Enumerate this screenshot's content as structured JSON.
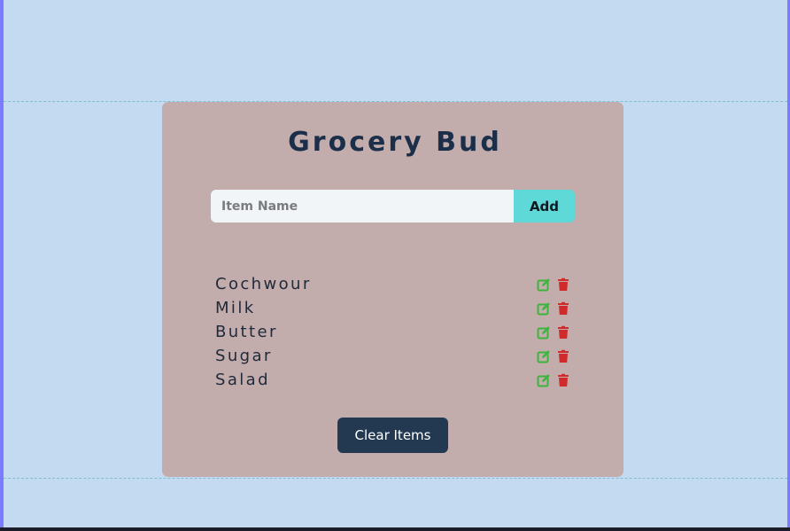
{
  "app": {
    "title": "Grocery Bud"
  },
  "form": {
    "input_placeholder": "Item Name",
    "input_value": "",
    "add_label": "Add"
  },
  "items": [
    {
      "label": "Cochwour",
      "edit_icon": "edit-icon",
      "delete_icon": "trash-icon"
    },
    {
      "label": "Milk",
      "edit_icon": "edit-icon",
      "delete_icon": "trash-icon"
    },
    {
      "label": "Butter",
      "edit_icon": "edit-icon",
      "delete_icon": "trash-icon"
    },
    {
      "label": "Sugar",
      "edit_icon": "edit-icon",
      "delete_icon": "trash-icon"
    },
    {
      "label": "Salad",
      "edit_icon": "edit-icon",
      "delete_icon": "trash-icon"
    }
  ],
  "actions": {
    "clear_label": "Clear Items"
  },
  "colors": {
    "page_background": "#c4daf0",
    "card_background": "#c3acac",
    "title": "#1c2f4a",
    "add_button": "#5fd8d8",
    "clear_button": "#233952",
    "edit_icon": "#3bb53b",
    "delete_icon": "#d12a2a"
  }
}
